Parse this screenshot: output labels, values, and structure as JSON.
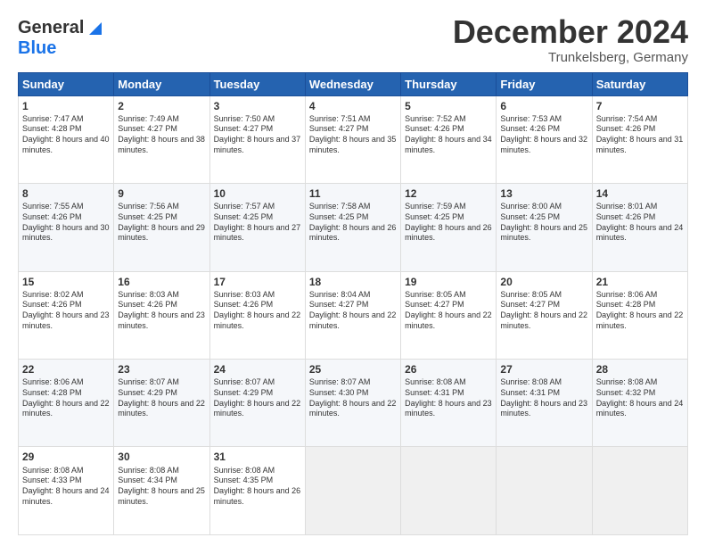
{
  "header": {
    "logo_line1": "General",
    "logo_line2": "Blue",
    "month": "December 2024",
    "location": "Trunkelsberg, Germany"
  },
  "days_of_week": [
    "Sunday",
    "Monday",
    "Tuesday",
    "Wednesday",
    "Thursday",
    "Friday",
    "Saturday"
  ],
  "weeks": [
    [
      {
        "day": "1",
        "rise": "7:47 AM",
        "set": "4:28 PM",
        "daylight": "8 hours and 40 minutes."
      },
      {
        "day": "2",
        "rise": "7:49 AM",
        "set": "4:27 PM",
        "daylight": "8 hours and 38 minutes."
      },
      {
        "day": "3",
        "rise": "7:50 AM",
        "set": "4:27 PM",
        "daylight": "8 hours and 37 minutes."
      },
      {
        "day": "4",
        "rise": "7:51 AM",
        "set": "4:27 PM",
        "daylight": "8 hours and 35 minutes."
      },
      {
        "day": "5",
        "rise": "7:52 AM",
        "set": "4:26 PM",
        "daylight": "8 hours and 34 minutes."
      },
      {
        "day": "6",
        "rise": "7:53 AM",
        "set": "4:26 PM",
        "daylight": "8 hours and 32 minutes."
      },
      {
        "day": "7",
        "rise": "7:54 AM",
        "set": "4:26 PM",
        "daylight": "8 hours and 31 minutes."
      }
    ],
    [
      {
        "day": "8",
        "rise": "7:55 AM",
        "set": "4:26 PM",
        "daylight": "8 hours and 30 minutes."
      },
      {
        "day": "9",
        "rise": "7:56 AM",
        "set": "4:25 PM",
        "daylight": "8 hours and 29 minutes."
      },
      {
        "day": "10",
        "rise": "7:57 AM",
        "set": "4:25 PM",
        "daylight": "8 hours and 27 minutes."
      },
      {
        "day": "11",
        "rise": "7:58 AM",
        "set": "4:25 PM",
        "daylight": "8 hours and 26 minutes."
      },
      {
        "day": "12",
        "rise": "7:59 AM",
        "set": "4:25 PM",
        "daylight": "8 hours and 26 minutes."
      },
      {
        "day": "13",
        "rise": "8:00 AM",
        "set": "4:25 PM",
        "daylight": "8 hours and 25 minutes."
      },
      {
        "day": "14",
        "rise": "8:01 AM",
        "set": "4:26 PM",
        "daylight": "8 hours and 24 minutes."
      }
    ],
    [
      {
        "day": "15",
        "rise": "8:02 AM",
        "set": "4:26 PM",
        "daylight": "8 hours and 23 minutes."
      },
      {
        "day": "16",
        "rise": "8:03 AM",
        "set": "4:26 PM",
        "daylight": "8 hours and 23 minutes."
      },
      {
        "day": "17",
        "rise": "8:03 AM",
        "set": "4:26 PM",
        "daylight": "8 hours and 22 minutes."
      },
      {
        "day": "18",
        "rise": "8:04 AM",
        "set": "4:27 PM",
        "daylight": "8 hours and 22 minutes."
      },
      {
        "day": "19",
        "rise": "8:05 AM",
        "set": "4:27 PM",
        "daylight": "8 hours and 22 minutes."
      },
      {
        "day": "20",
        "rise": "8:05 AM",
        "set": "4:27 PM",
        "daylight": "8 hours and 22 minutes."
      },
      {
        "day": "21",
        "rise": "8:06 AM",
        "set": "4:28 PM",
        "daylight": "8 hours and 22 minutes."
      }
    ],
    [
      {
        "day": "22",
        "rise": "8:06 AM",
        "set": "4:28 PM",
        "daylight": "8 hours and 22 minutes."
      },
      {
        "day": "23",
        "rise": "8:07 AM",
        "set": "4:29 PM",
        "daylight": "8 hours and 22 minutes."
      },
      {
        "day": "24",
        "rise": "8:07 AM",
        "set": "4:29 PM",
        "daylight": "8 hours and 22 minutes."
      },
      {
        "day": "25",
        "rise": "8:07 AM",
        "set": "4:30 PM",
        "daylight": "8 hours and 22 minutes."
      },
      {
        "day": "26",
        "rise": "8:08 AM",
        "set": "4:31 PM",
        "daylight": "8 hours and 23 minutes."
      },
      {
        "day": "27",
        "rise": "8:08 AM",
        "set": "4:31 PM",
        "daylight": "8 hours and 23 minutes."
      },
      {
        "day": "28",
        "rise": "8:08 AM",
        "set": "4:32 PM",
        "daylight": "8 hours and 24 minutes."
      }
    ],
    [
      {
        "day": "29",
        "rise": "8:08 AM",
        "set": "4:33 PM",
        "daylight": "8 hours and 24 minutes."
      },
      {
        "day": "30",
        "rise": "8:08 AM",
        "set": "4:34 PM",
        "daylight": "8 hours and 25 minutes."
      },
      {
        "day": "31",
        "rise": "8:08 AM",
        "set": "4:35 PM",
        "daylight": "8 hours and 26 minutes."
      },
      null,
      null,
      null,
      null
    ]
  ]
}
